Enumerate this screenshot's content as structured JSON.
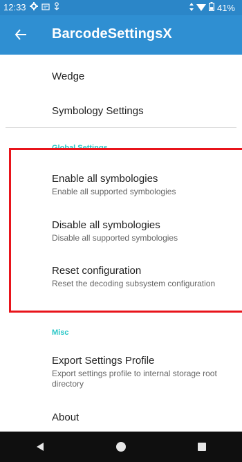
{
  "status_bar": {
    "time": "12:33",
    "battery": "41%",
    "icons": [
      "gear-icon",
      "notification-icon",
      "download-icon",
      "data-arrows-icon",
      "wifi-icon",
      "battery-icon"
    ]
  },
  "app_bar": {
    "title": "BarcodeSettingsX",
    "back_icon": "back-arrow-icon"
  },
  "items_top": [
    {
      "title": "Wedge"
    },
    {
      "title": "Symbology Settings"
    }
  ],
  "global_settings": {
    "category": "Global Settings",
    "items": [
      {
        "title": "Enable all symbologies",
        "summary": "Enable all supported symbologies"
      },
      {
        "title": "Disable all symbologies",
        "summary": "Disable all supported symbologies"
      },
      {
        "title": "Reset configuration",
        "summary": "Reset the decoding subsystem configuration"
      }
    ]
  },
  "misc": {
    "category": "Misc",
    "items": [
      {
        "title": "Export Settings Profile",
        "summary": "Export settings profile to internal storage root directory"
      },
      {
        "title": "About"
      }
    ]
  },
  "nav_bar": {
    "buttons": [
      "back-triangle-icon",
      "home-circle-icon",
      "recents-square-icon"
    ]
  },
  "colors": {
    "status_bar": "#2b86c8",
    "app_bar": "#2f8fd2",
    "category_accent": "#26c6c6",
    "highlight": "#e8141b",
    "nav_bar": "#0f0f0f"
  }
}
